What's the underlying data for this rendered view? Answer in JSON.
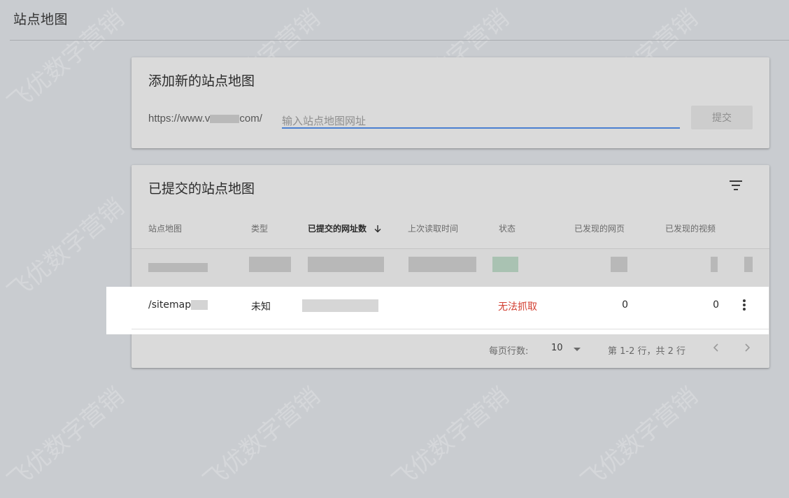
{
  "page": {
    "title": "站点地图"
  },
  "add_sitemap": {
    "title": "添加新的站点地图",
    "url_prefix_start": "https://www.v",
    "url_prefix_end": "com/",
    "input_placeholder": "输入站点地图网址",
    "submit_label": "提交"
  },
  "submitted": {
    "title": "已提交的站点地图",
    "columns": [
      "站点地图",
      "类型",
      "已提交的网址数",
      "上次读取时间",
      "状态",
      "已发现的网页",
      "已发现的视频"
    ],
    "rows": [
      {
        "sitemap": "/sitemap",
        "type": "未知",
        "status": "无法抓取",
        "pages": "0",
        "videos": "0"
      }
    ],
    "pagination": {
      "rows_per_page_label": "每页行数:",
      "rows_per_page_value": "10",
      "range_text": "第 1-2 行，共 2 行"
    }
  },
  "icons": {
    "filter": "filter-icon",
    "sort": "arrow-down-icon",
    "more": "more-vert-icon",
    "dropdown": "caret-down-icon",
    "prev": "chevron-left-icon",
    "next": "chevron-right-icon"
  },
  "colors": {
    "status_error": "#d23f31",
    "input_underline": "#4a7fd0"
  }
}
